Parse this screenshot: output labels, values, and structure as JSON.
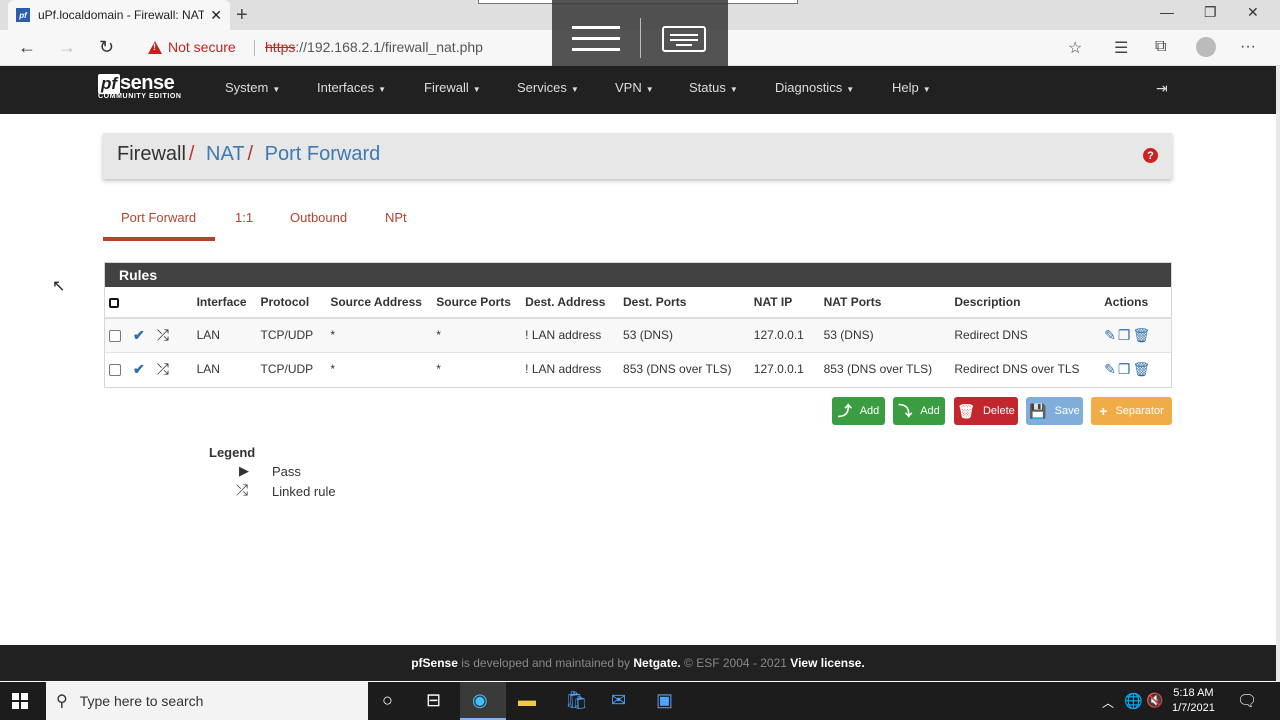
{
  "browser": {
    "tab_title": "uPf.localdomain - Firewall: NAT: P",
    "tab_favicon": "pf",
    "not_secure": "Not secure",
    "url_scheme": "https",
    "url_rest": "://192.168.2.1/firewall_nat.php"
  },
  "pfsense": {
    "logo_pf": "pf",
    "logo_sense": "sense",
    "logo_edition": "COMMUNITY EDITION",
    "nav": [
      "System",
      "Interfaces",
      "Firewall",
      "Services",
      "VPN",
      "Status",
      "Diagnostics",
      "Help"
    ]
  },
  "breadcrumb": {
    "root": "Firewall",
    "level2": "NAT",
    "level3": "Port Forward",
    "help": "?"
  },
  "tabs": [
    "Port Forward",
    "1:1",
    "Outbound",
    "NPt"
  ],
  "rules": {
    "title": "Rules",
    "headers": [
      "Interface",
      "Protocol",
      "Source Address",
      "Source Ports",
      "Dest. Address",
      "Dest. Ports",
      "NAT IP",
      "NAT Ports",
      "Description",
      "Actions"
    ],
    "rows": [
      {
        "interface": "LAN",
        "protocol": "TCP/UDP",
        "src_addr": "*",
        "src_ports": "*",
        "dst_addr": "! LAN address",
        "dst_ports": "53 (DNS)",
        "nat_ip": "127.0.0.1",
        "nat_ports": "53 (DNS)",
        "description": "Redirect DNS"
      },
      {
        "interface": "LAN",
        "protocol": "TCP/UDP",
        "src_addr": "*",
        "src_ports": "*",
        "dst_addr": "! LAN address",
        "dst_ports": "853 (DNS over TLS)",
        "nat_ip": "127.0.0.1",
        "nat_ports": "853 (DNS over TLS)",
        "description": "Redirect DNS over TLS"
      }
    ]
  },
  "buttons": {
    "add_top": "Add",
    "add_bottom": "Add",
    "delete": "Delete",
    "save": "Save",
    "separator": "Separator"
  },
  "legend": {
    "title": "Legend",
    "pass": "Pass",
    "linked": "Linked rule"
  },
  "footer": {
    "brand": "pfSense",
    "text1": " is developed and maintained by ",
    "netgate": "Netgate.",
    "text2": " © ESF 2004 - 2021 ",
    "license": "View license."
  },
  "taskbar": {
    "search_placeholder": "Type here to search",
    "time": "5:18 AM",
    "date": "1/7/2021"
  },
  "colors": {
    "header_bg": "#212121",
    "accent_red": "#b3432d",
    "link_blue": "#3c7ab3",
    "btn_green": "#3a9d42",
    "btn_red": "#c1272d",
    "btn_blue": "#7eaed9",
    "btn_orange": "#f0ac47"
  }
}
